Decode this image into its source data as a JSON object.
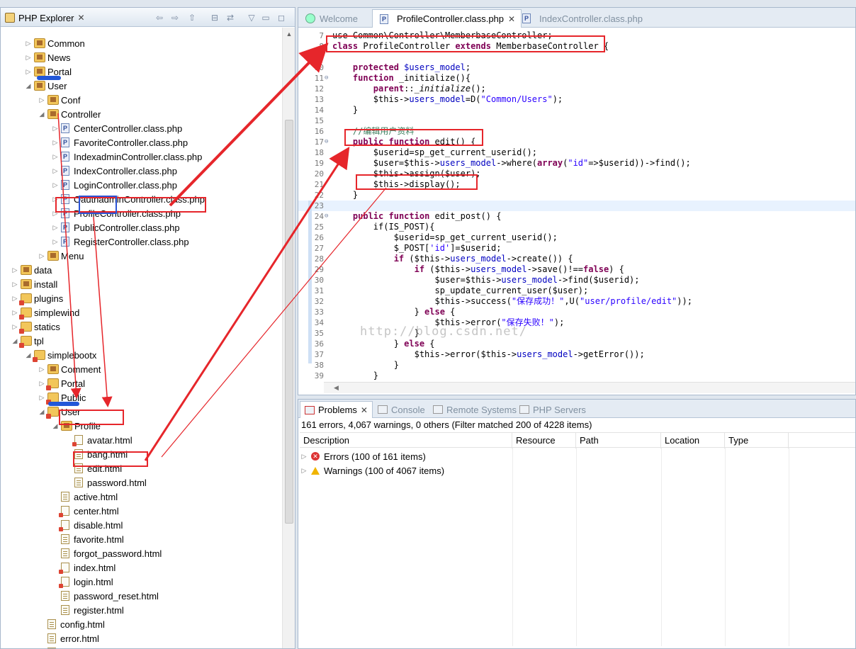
{
  "explorer": {
    "title": "PHP Explorer",
    "tree": [
      {
        "label": "Common",
        "type": "pkg",
        "arrow": "▷",
        "level": 2
      },
      {
        "label": "News",
        "type": "pkg",
        "arrow": "▷",
        "level": 2
      },
      {
        "label": "Portal",
        "type": "pkg",
        "arrow": "▷",
        "level": 2
      },
      {
        "label": "User",
        "type": "pkg",
        "arrow": "◢",
        "level": 2
      },
      {
        "label": "Conf",
        "type": "pkg",
        "arrow": "▷",
        "level": 3
      },
      {
        "label": "Controller",
        "type": "pkg",
        "arrow": "◢",
        "level": 3
      },
      {
        "label": "CenterController.class.php",
        "type": "php",
        "arrow": "▷",
        "level": 4
      },
      {
        "label": "FavoriteController.class.php",
        "type": "php",
        "arrow": "▷",
        "level": 4
      },
      {
        "label": "IndexadminController.class.php",
        "type": "php",
        "arrow": "▷",
        "level": 4
      },
      {
        "label": "IndexController.class.php",
        "type": "php",
        "arrow": "▷",
        "level": 4
      },
      {
        "label": "LoginController.class.php",
        "type": "php",
        "arrow": "▷",
        "level": 4
      },
      {
        "label": "OauthadminController.class.php",
        "type": "php",
        "arrow": "▷",
        "level": 4
      },
      {
        "label": "ProfileController.class.php",
        "type": "php",
        "arrow": "▷",
        "level": 4
      },
      {
        "label": "PublicController.class.php",
        "type": "php",
        "arrow": "▷",
        "level": 4
      },
      {
        "label": "RegisterController.class.php",
        "type": "php",
        "arrow": "▷",
        "level": 4
      },
      {
        "label": "Menu",
        "type": "pkg",
        "arrow": "▷",
        "level": 3
      },
      {
        "label": "data",
        "type": "pkg",
        "arrow": "▷",
        "level": 1
      },
      {
        "label": "install",
        "type": "pkg",
        "arrow": "▷",
        "level": 1
      },
      {
        "label": "plugins",
        "type": "pkgerr",
        "arrow": "▷",
        "level": 1
      },
      {
        "label": "simplewind",
        "type": "pkgerr",
        "arrow": "▷",
        "level": 1
      },
      {
        "label": "statics",
        "type": "pkgerr",
        "arrow": "▷",
        "level": 1
      },
      {
        "label": "tpl",
        "type": "pkgerr",
        "arrow": "◢",
        "level": 1
      },
      {
        "label": "simplebootx",
        "type": "pkgerr",
        "arrow": "◢",
        "level": 2
      },
      {
        "label": "Comment",
        "type": "pkg",
        "arrow": "▷",
        "level": 3
      },
      {
        "label": "Portal",
        "type": "pkgerr",
        "arrow": "▷",
        "level": 3
      },
      {
        "label": "Public",
        "type": "pkgerr",
        "arrow": "▷",
        "level": 3
      },
      {
        "label": "User",
        "type": "pkgerr",
        "arrow": "◢",
        "level": 3
      },
      {
        "label": "Profile",
        "type": "pkg",
        "arrow": "◢",
        "level": 4
      },
      {
        "label": "avatar.html",
        "type": "htmlerr",
        "arrow": "",
        "level": 5
      },
      {
        "label": "bang.html",
        "type": "html",
        "arrow": "",
        "level": 5
      },
      {
        "label": "edit.html",
        "type": "html",
        "arrow": "",
        "level": 5
      },
      {
        "label": "password.html",
        "type": "html",
        "arrow": "",
        "level": 5
      },
      {
        "label": "active.html",
        "type": "html",
        "arrow": "",
        "level": 4
      },
      {
        "label": "center.html",
        "type": "htmlerr",
        "arrow": "",
        "level": 4
      },
      {
        "label": "disable.html",
        "type": "htmlerr",
        "arrow": "",
        "level": 4
      },
      {
        "label": "favorite.html",
        "type": "html",
        "arrow": "",
        "level": 4
      },
      {
        "label": "forgot_password.html",
        "type": "html",
        "arrow": "",
        "level": 4
      },
      {
        "label": "index.html",
        "type": "htmlerr",
        "arrow": "",
        "level": 4
      },
      {
        "label": "login.html",
        "type": "htmlerr",
        "arrow": "",
        "level": 4
      },
      {
        "label": "password_reset.html",
        "type": "html",
        "arrow": "",
        "level": 4
      },
      {
        "label": "register.html",
        "type": "html",
        "arrow": "",
        "level": 4
      },
      {
        "label": "config.html",
        "type": "html",
        "arrow": "",
        "level": 3
      },
      {
        "label": "error.html",
        "type": "html",
        "arrow": "",
        "level": 3
      },
      {
        "label": "function.html",
        "type": "html",
        "arrow": "",
        "level": 3
      }
    ]
  },
  "editor": {
    "tabs": [
      {
        "label": "Welcome",
        "active": false
      },
      {
        "label": "ProfileController.class.php",
        "active": true
      },
      {
        "label": "IndexController.class.php",
        "active": false
      }
    ],
    "lines": [
      {
        "n": "7",
        "fold": "",
        "t": "use Common\\Controller\\MemberbaseController;"
      },
      {
        "n": "8",
        "fold": "",
        "t": "<span class='kw'>class</span> ProfileController <span class='kw'>extends</span> MemberbaseController {"
      },
      {
        "n": "9",
        "fold": "",
        "t": ""
      },
      {
        "n": "10",
        "fold": "",
        "t": "    <span class='kw'>protected</span> <span class='var'>$users_model</span>;"
      },
      {
        "n": "11",
        "fold": "⊖",
        "t": "    <span class='kw'>function</span> _initialize(){"
      },
      {
        "n": "12",
        "fold": "",
        "t": "        <span class='kw'>parent</span>::<i>_initialize</i>();"
      },
      {
        "n": "13",
        "fold": "",
        "t": "        $this-><span class='var'>users_model</span>=D(<span class='str'>\"Common/Users\"</span>);"
      },
      {
        "n": "14",
        "fold": "",
        "t": "    }"
      },
      {
        "n": "15",
        "fold": "",
        "t": ""
      },
      {
        "n": "16",
        "fold": "",
        "t": "    <span class='cm'>//编辑用户资料</span>"
      },
      {
        "n": "17",
        "fold": "⊖",
        "t": "    <span class='kw'>public</span> <span class='kw'>function</span> edit() {"
      },
      {
        "n": "18",
        "fold": "",
        "t": "        $userid=sp_get_current_userid();"
      },
      {
        "n": "19",
        "fold": "",
        "t": "        $user=$this-><span class='var'>users_model</span>->where(<span class='kw'>array</span>(<span class='str'>\"id\"</span>=>$userid))->find();"
      },
      {
        "n": "20",
        "fold": "",
        "t": "        $this->assign($user);"
      },
      {
        "n": "21",
        "fold": "",
        "t": "        $this->display();"
      },
      {
        "n": "22",
        "fold": "",
        "t": "    }"
      },
      {
        "n": "23",
        "fold": "",
        "t": ""
      },
      {
        "n": "24",
        "fold": "⊖",
        "t": "    <span class='kw'>public</span> <span class='kw'>function</span> edit_post() {"
      },
      {
        "n": "25",
        "fold": "",
        "t": "        if(IS_POST){"
      },
      {
        "n": "26",
        "fold": "",
        "t": "            $userid=sp_get_current_userid();"
      },
      {
        "n": "27",
        "fold": "",
        "t": "            $_POST[<span class='str'>'id'</span>]=$userid;"
      },
      {
        "n": "28",
        "fold": "",
        "t": "            <span class='kw'>if</span> ($this-><span class='var'>users_model</span>->create()) {"
      },
      {
        "n": "29",
        "fold": "",
        "t": "                <span class='kw'>if</span> ($this-><span class='var'>users_model</span>->save()!==<span class='kw'>false</span>) {"
      },
      {
        "n": "30",
        "fold": "",
        "t": "                    $user=$this-><span class='var'>users_model</span>->find($userid);"
      },
      {
        "n": "31",
        "fold": "",
        "t": "                    sp_update_current_user($user);"
      },
      {
        "n": "32",
        "fold": "",
        "t": "                    $this->success(<span class='str'>\"保存成功！\"</span>,U(<span class='str'>\"user/profile/edit\"</span>));"
      },
      {
        "n": "33",
        "fold": "",
        "t": "                } <span class='kw'>else</span> {"
      },
      {
        "n": "34",
        "fold": "",
        "t": "                    $this->error(<span class='str'>\"保存失败！\"</span>);"
      },
      {
        "n": "35",
        "fold": "",
        "t": "                }"
      },
      {
        "n": "36",
        "fold": "",
        "t": "            } <span class='kw'>else</span> {"
      },
      {
        "n": "37",
        "fold": "",
        "t": "                $this->error($this-><span class='var'>users_model</span>->getError());"
      },
      {
        "n": "38",
        "fold": "",
        "t": "            }"
      },
      {
        "n": "39",
        "fold": "",
        "t": "        }"
      }
    ]
  },
  "problems": {
    "tabs": [
      "Problems",
      "Console",
      "Remote Systems",
      "PHP Servers"
    ],
    "summary": "161 errors, 4,067 warnings, 0 others (Filter matched 200 of 4228 items)",
    "columns": [
      "Description",
      "Resource",
      "Path",
      "Location",
      "Type"
    ],
    "rows": [
      {
        "kind": "error",
        "label": "Errors (100 of 161 items)"
      },
      {
        "kind": "warning",
        "label": "Warnings (100 of 4067 items)"
      }
    ]
  },
  "watermark": "http://blog.csdn.net/"
}
